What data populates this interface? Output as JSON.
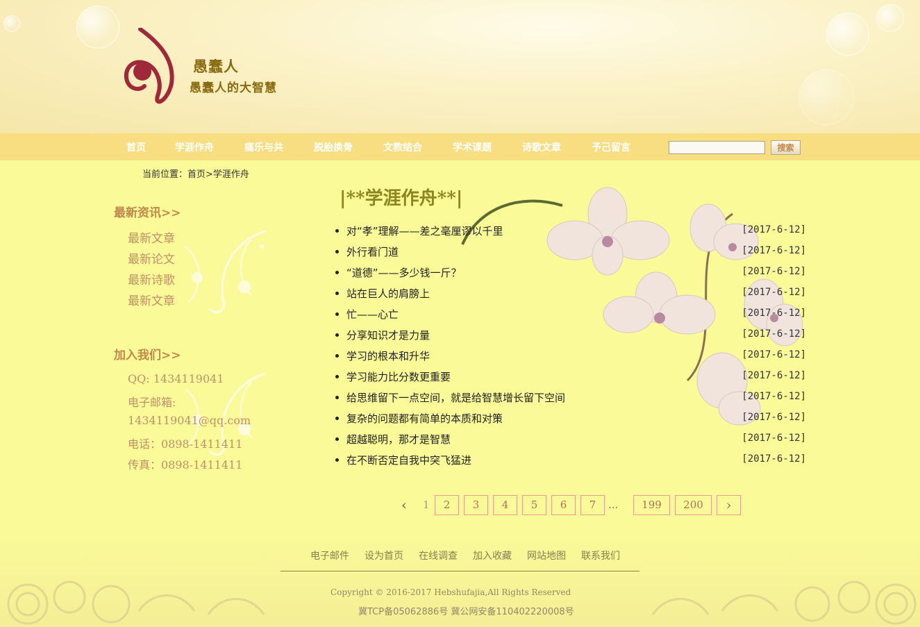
{
  "site": {
    "name": "愚蠢人",
    "slogan": "愚蠢人的大智慧"
  },
  "nav": {
    "items": [
      "首页",
      "学涯作舟",
      "痛乐与共",
      "脱胎换骨",
      "文教结合",
      "学术课题",
      "诗歌文章",
      "予己留言"
    ],
    "search_value": "",
    "search_label": "搜索"
  },
  "breadcrumb": "当前位置：首页>学涯作舟",
  "sidebar": {
    "news_title": "最新资讯>>",
    "news_links": [
      "最新文章",
      "最新论文",
      "最新诗歌",
      "最新文章"
    ],
    "join_title": "加入我们>>",
    "qq": "QQ: 1434119041",
    "email_label": "电子邮箱:",
    "email": "1434119041@qq.com",
    "phone": "电话：0898-1411411",
    "fax": "传真：0898-1411411"
  },
  "main": {
    "title": "|**学涯作舟**|",
    "articles": [
      {
        "title": "对“孝”理解——差之毫厘谬以千里",
        "date": "[2017-6-12]"
      },
      {
        "title": "外行看门道",
        "date": "[2017-6-12]"
      },
      {
        "title": "“道德”——多少钱一斤？",
        "date": "[2017-6-12]"
      },
      {
        "title": "站在巨人的肩膀上",
        "date": "[2017-6-12]"
      },
      {
        "title": "忙——心亡",
        "date": "[2017-6-12]"
      },
      {
        "title": "分享知识才是力量",
        "date": "[2017-6-12]"
      },
      {
        "title": "学习的根本和升华",
        "date": "[2017-6-12]"
      },
      {
        "title": "学习能力比分数更重要",
        "date": "[2017-6-12]"
      },
      {
        "title": "给思维留下一点空间，就是给智慧增长留下空间",
        "date": "[2017-6-12]"
      },
      {
        "title": "复杂的问题都有简单的本质和对策",
        "date": "[2017-6-12]"
      },
      {
        "title": "超越聪明，那才是智慧",
        "date": "[2017-6-12]"
      },
      {
        "title": "在不断否定自我中突飞猛进",
        "date": "[2017-6-12]"
      }
    ]
  },
  "pagination": {
    "prev": "‹",
    "current": "1",
    "pages": [
      "2",
      "3",
      "4",
      "5",
      "6",
      "7"
    ],
    "ellipsis": "...",
    "last_pages": [
      "199",
      "200"
    ],
    "next": "›"
  },
  "footer": {
    "links": [
      "电子邮件",
      "设为首页",
      "在线调查",
      "加入收藏",
      "网站地图",
      "联系我们"
    ],
    "copyright": "Copyright © 2016-2017 Hebshufajia,All Rights Reserved",
    "icp": "冀TCP备05062886号 冀公网安备110402220008号"
  },
  "colors": {
    "page_bg": "#fafa98",
    "nav_bg": "#f8de80",
    "accent_brown": "#c0884a",
    "title_olive": "#8c8420",
    "logo_red": "#a0283a"
  }
}
